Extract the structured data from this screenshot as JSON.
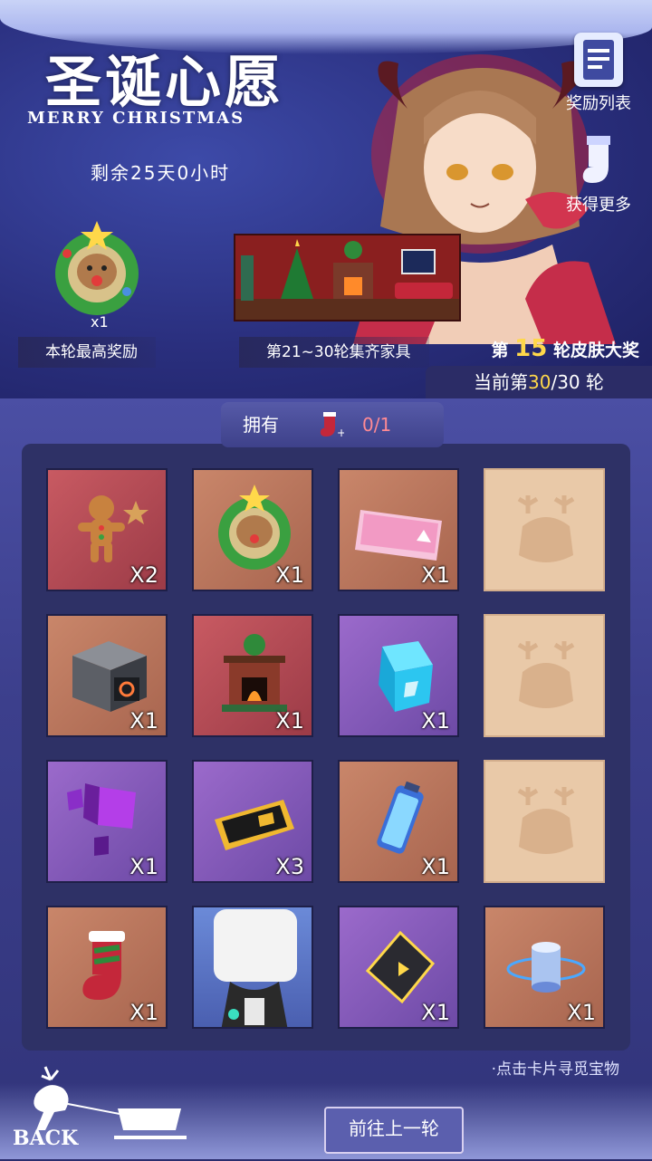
{
  "header": {
    "title": "圣诞心愿",
    "subtitle": "MERRY CHRISTMAS",
    "remaining": "剩余25天0小时"
  },
  "side_buttons": {
    "reward_list": "奖励列表",
    "get_more": "获得更多"
  },
  "top_reward": {
    "count": "x1",
    "label": "本轮最高奖励"
  },
  "furniture": {
    "label": "第21~30轮集齐家具"
  },
  "skin_prize": {
    "prefix": "第",
    "number": "15",
    "suffix": "轮皮肤大奖"
  },
  "round": {
    "prefix": "当前第",
    "current": "30",
    "suffix": "/30 轮"
  },
  "owned": {
    "label": "拥有",
    "count": "0/1"
  },
  "grid": [
    {
      "name": "gingerbread",
      "qty": "X2",
      "rarity": "red"
    },
    {
      "name": "reindeer-wreath",
      "qty": "X1",
      "rarity": "orange"
    },
    {
      "name": "ticket-pink",
      "qty": "X1",
      "rarity": "orange"
    },
    {
      "name": "locked",
      "qty": "",
      "rarity": "locked"
    },
    {
      "name": "supply-box",
      "qty": "X1",
      "rarity": "orange"
    },
    {
      "name": "fireplace",
      "qty": "X1",
      "rarity": "red"
    },
    {
      "name": "cyan-cube",
      "qty": "X1",
      "rarity": "purple"
    },
    {
      "name": "locked",
      "qty": "",
      "rarity": "locked"
    },
    {
      "name": "purple-cubes",
      "qty": "X1",
      "rarity": "purple"
    },
    {
      "name": "gold-ticket",
      "qty": "X3",
      "rarity": "purple"
    },
    {
      "name": "battery",
      "qty": "X1",
      "rarity": "orange"
    },
    {
      "name": "locked",
      "qty": "",
      "rarity": "locked"
    },
    {
      "name": "stocking",
      "qty": "X1",
      "rarity": "orange"
    },
    {
      "name": "character-card",
      "qty": "",
      "rarity": "blue"
    },
    {
      "name": "dark-crystal",
      "qty": "X1",
      "rarity": "purple"
    },
    {
      "name": "blue-cylinder",
      "qty": "X1",
      "rarity": "orange"
    }
  ],
  "hint": "·点击卡片寻觅宝物",
  "back_label": "BACK",
  "prev_round": "前往上一轮",
  "colors": {
    "accent": "#ffd84a",
    "count": "#ff8a94"
  }
}
